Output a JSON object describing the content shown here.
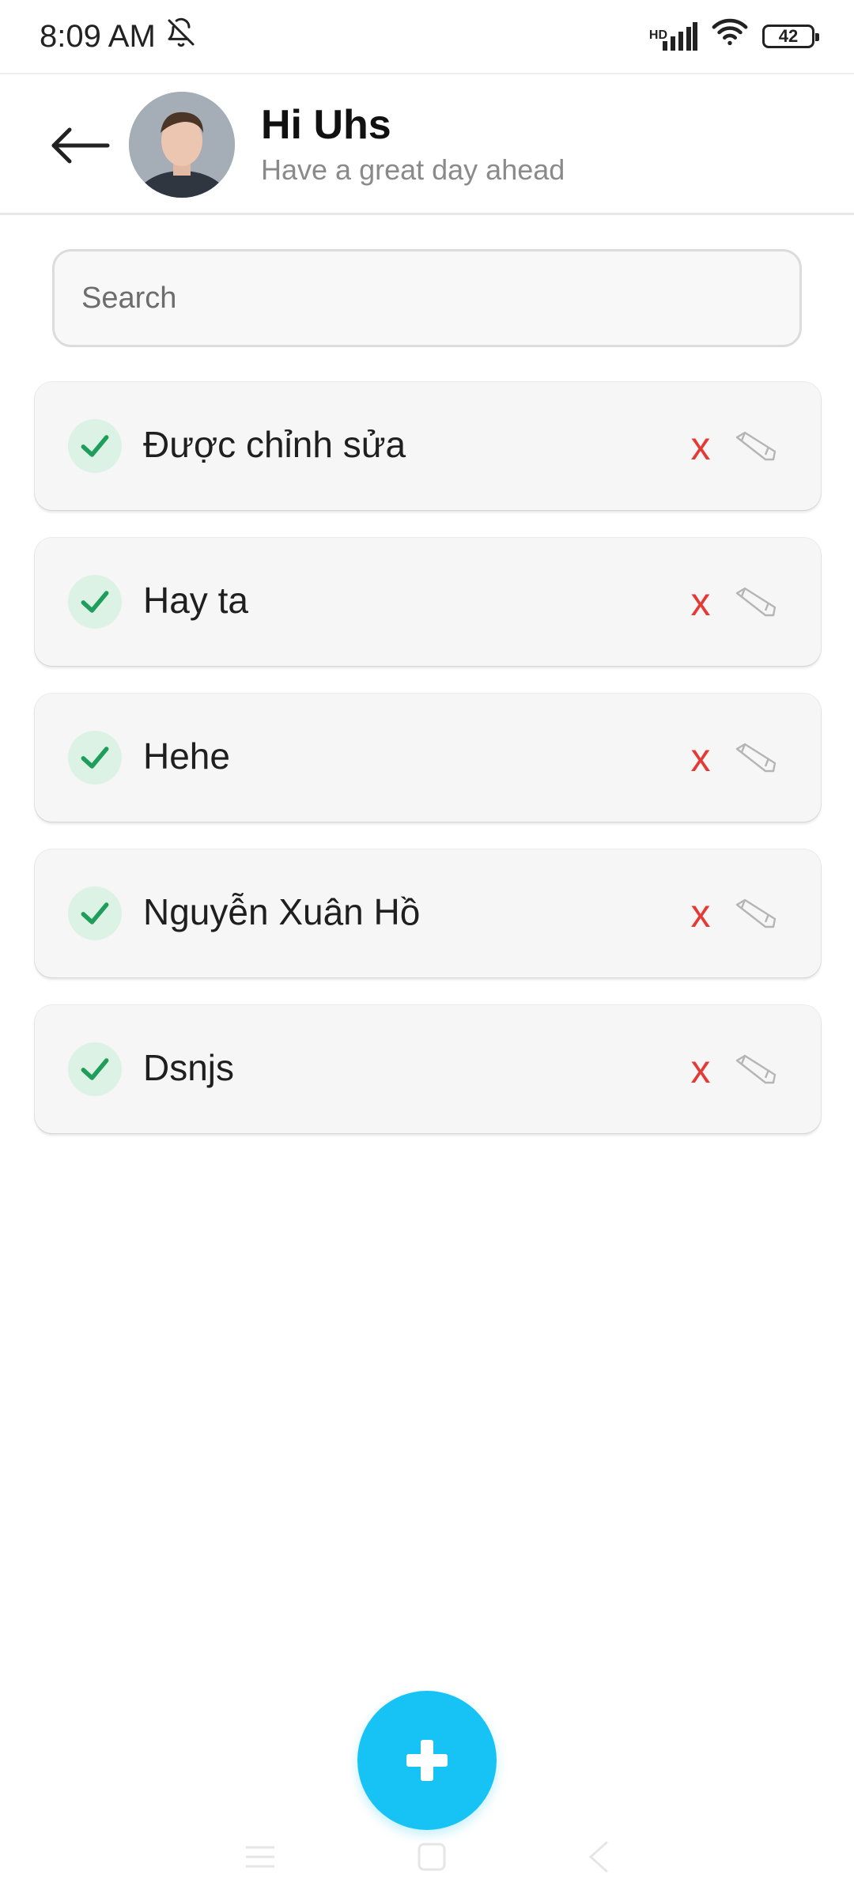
{
  "status_bar": {
    "time": "8:09 AM",
    "battery": "42",
    "network_tag": "HD",
    "icons": [
      "bell-off-icon",
      "signal-icon",
      "wifi-icon",
      "battery-icon"
    ]
  },
  "header": {
    "title": "Hi Uhs",
    "subtitle": "Have a great day ahead",
    "back_icon": "arrow-left-icon",
    "avatar": "user-avatar"
  },
  "search": {
    "placeholder": "Search",
    "value": ""
  },
  "tasks": [
    {
      "label": "Được chỉnh sửa",
      "done": true,
      "delete_label": "x"
    },
    {
      "label": "Hay ta",
      "done": true,
      "delete_label": "x"
    },
    {
      "label": "Hehe",
      "done": true,
      "delete_label": "x"
    },
    {
      "label": "Nguyễn Xuân Hồ",
      "done": true,
      "delete_label": "x"
    },
    {
      "label": "Dsnjs",
      "done": true,
      "delete_label": "x"
    }
  ],
  "fab": {
    "icon": "plus-icon"
  },
  "nav_bar": {
    "icons": [
      "menu-icon",
      "home-icon",
      "back-icon"
    ]
  },
  "colors": {
    "accent": "#17c3f5",
    "check": "#1e9e5a",
    "check_bg": "#dcf2e4",
    "delete": "#e53935",
    "card_bg": "#f6f6f6"
  }
}
